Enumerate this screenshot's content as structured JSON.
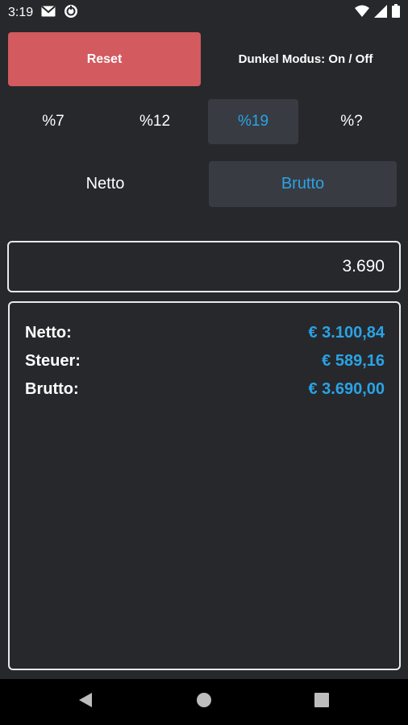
{
  "status_bar": {
    "time": "3:19",
    "icons": [
      "gmail-icon",
      "sync-icon",
      "wifi-icon",
      "signal-icon",
      "battery-icon"
    ]
  },
  "top": {
    "reset_label": "Reset",
    "dark_mode_label": "Dunkel Modus: On / Off"
  },
  "tax_rates": {
    "options": [
      "%7",
      "%12",
      "%19",
      "%?"
    ],
    "selected": "%19"
  },
  "mode": {
    "netto_label": "Netto",
    "brutto_label": "Brutto",
    "selected": "Brutto"
  },
  "input": {
    "value": "3.690"
  },
  "results": {
    "netto_label": "Netto:",
    "netto_value": "€ 3.100,84",
    "steuer_label": "Steuer:",
    "steuer_value": "€ 589,16",
    "brutto_label": "Brutto:",
    "brutto_value": "€ 3.690,00"
  },
  "colors": {
    "background": "#27282c",
    "accent": "#2aa3e6",
    "reset": "#d35a5f",
    "selected_bg": "#393b42"
  },
  "nav_bar": {
    "icons": [
      "back-icon",
      "home-icon",
      "recents-icon"
    ]
  }
}
